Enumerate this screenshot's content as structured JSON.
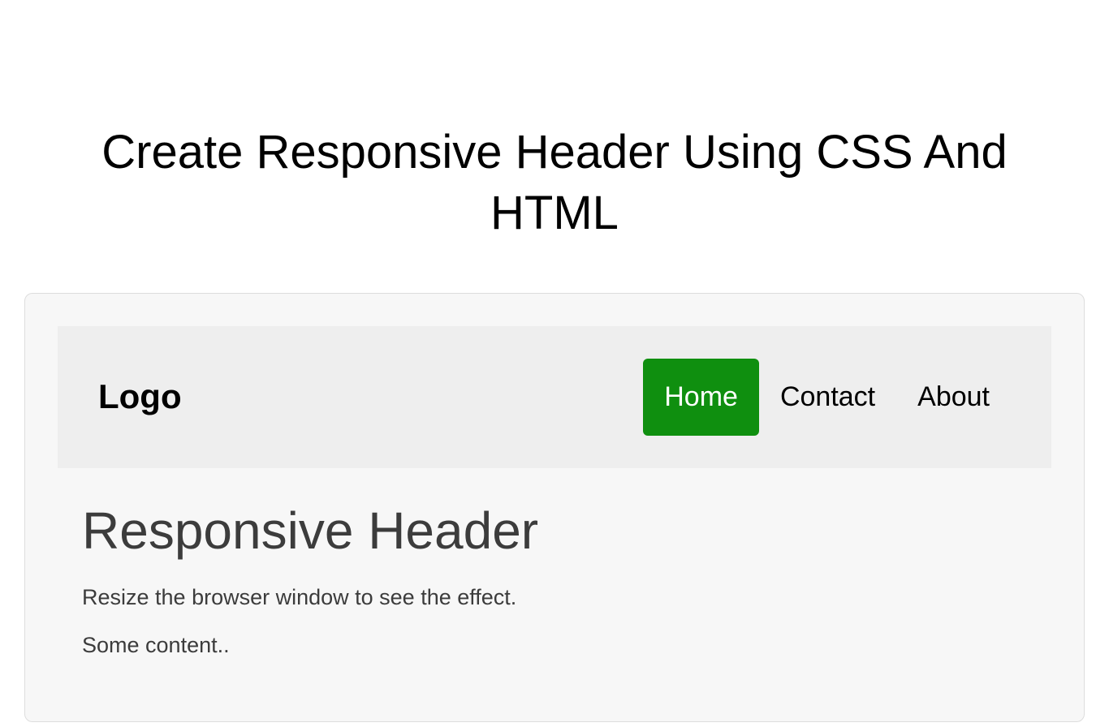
{
  "page": {
    "title": "Create Responsive Header Using CSS And HTML"
  },
  "header": {
    "logo": "Logo",
    "nav": {
      "home": "Home",
      "contact": "Contact",
      "about": "About"
    }
  },
  "content": {
    "heading": "Responsive Header",
    "line1": "Resize the browser window to see the effect.",
    "line2": "Some content.."
  }
}
